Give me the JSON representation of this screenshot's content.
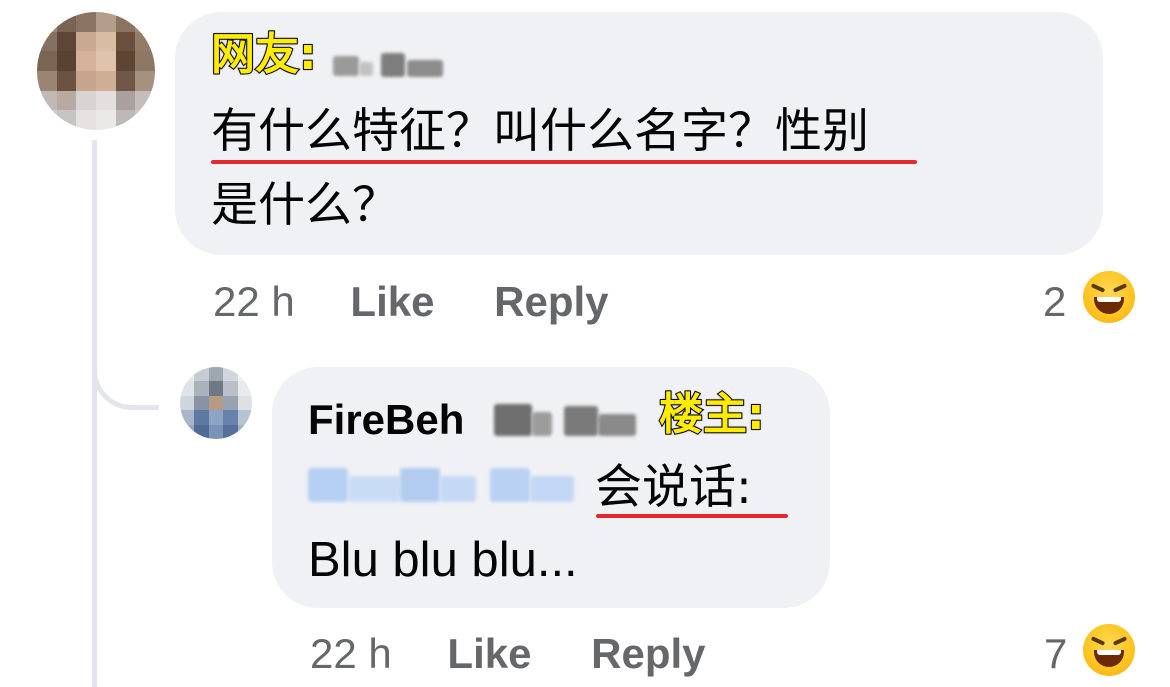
{
  "comment1": {
    "tag": "网友:",
    "line1": "有什么特征？叫什么名字？性别",
    "line2": "是什么？",
    "time": "22 h",
    "like": "Like",
    "reply": "Reply",
    "reaction_count": "2",
    "reaction_icon": "laughing-emoji"
  },
  "comment2": {
    "author": "FireBeh",
    "tag": "楼主:",
    "line1": "会说话:",
    "line2": "Blu blu blu...",
    "time": "22 h",
    "like": "Like",
    "reply": "Reply",
    "reaction_count": "7",
    "reaction_icon": "laughing-emoji"
  },
  "colors": {
    "bubble": "#f0f1f4",
    "meta_text": "#65676b",
    "tag_fill": "#ffec00",
    "underline": "#e0282d",
    "mention_blur": "#b9d4f5"
  }
}
